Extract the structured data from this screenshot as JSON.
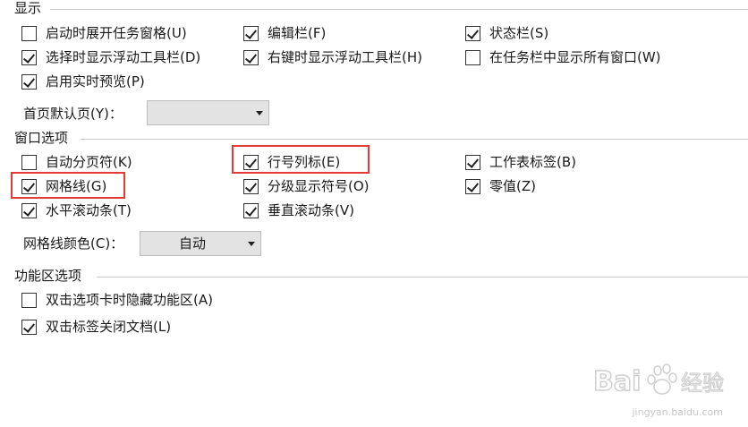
{
  "sections": {
    "display": "显示",
    "window": "窗口选项",
    "ribbon": "功能区选项"
  },
  "display": {
    "opt_startup_taskpane": {
      "label": "启动时展开任务窗格(U)",
      "checked": false
    },
    "opt_formula_bar": {
      "label": "编辑栏(F)",
      "checked": true
    },
    "opt_status_bar": {
      "label": "状态栏(S)",
      "checked": true
    },
    "opt_select_floating_toolbar": {
      "label": "选择时显示浮动工具栏(D)",
      "checked": true
    },
    "opt_rightclick_floating_toolbar": {
      "label": "右键时显示浮动工具栏(H)",
      "checked": true
    },
    "opt_taskbar_all_windows": {
      "label": "在任务栏中显示所有窗口(W)",
      "checked": false
    },
    "opt_live_preview": {
      "label": "启用实时预览(P)",
      "checked": true
    },
    "home_page_label": "首页默认页(Y)：",
    "home_page_value": ""
  },
  "window": {
    "opt_page_breaks": {
      "label": "自动分页符(K)",
      "checked": false
    },
    "opt_row_col_headers": {
      "label": "行号列标(E)",
      "checked": true
    },
    "opt_sheet_tabs": {
      "label": "工作表标签(B)",
      "checked": true
    },
    "opt_gridlines": {
      "label": "网格线(G)",
      "checked": true
    },
    "opt_outline_symbols": {
      "label": "分级显示符号(O)",
      "checked": true
    },
    "opt_zero_values": {
      "label": "零值(Z)",
      "checked": true
    },
    "opt_horizontal_scroll": {
      "label": "水平滚动条(T)",
      "checked": true
    },
    "opt_vertical_scroll": {
      "label": "垂直滚动条(V)",
      "checked": true
    },
    "gridline_color_label": "网格线颜色(C)：",
    "gridline_color_value": "自动"
  },
  "ribbon": {
    "opt_hide_on_dblclick": {
      "label": "双击选项卡时隐藏功能区(A)",
      "checked": false
    },
    "opt_close_on_dblclick": {
      "label": "双击标签关闭文档(L)",
      "checked": true
    }
  },
  "colors": {
    "highlight": "#e53935",
    "rule": "#c8c8c8",
    "combo_bg": "#e3e3e3"
  },
  "watermark": {
    "brand": "Bai",
    "brand2": "经验",
    "url": "jingyan.baidu.com"
  }
}
